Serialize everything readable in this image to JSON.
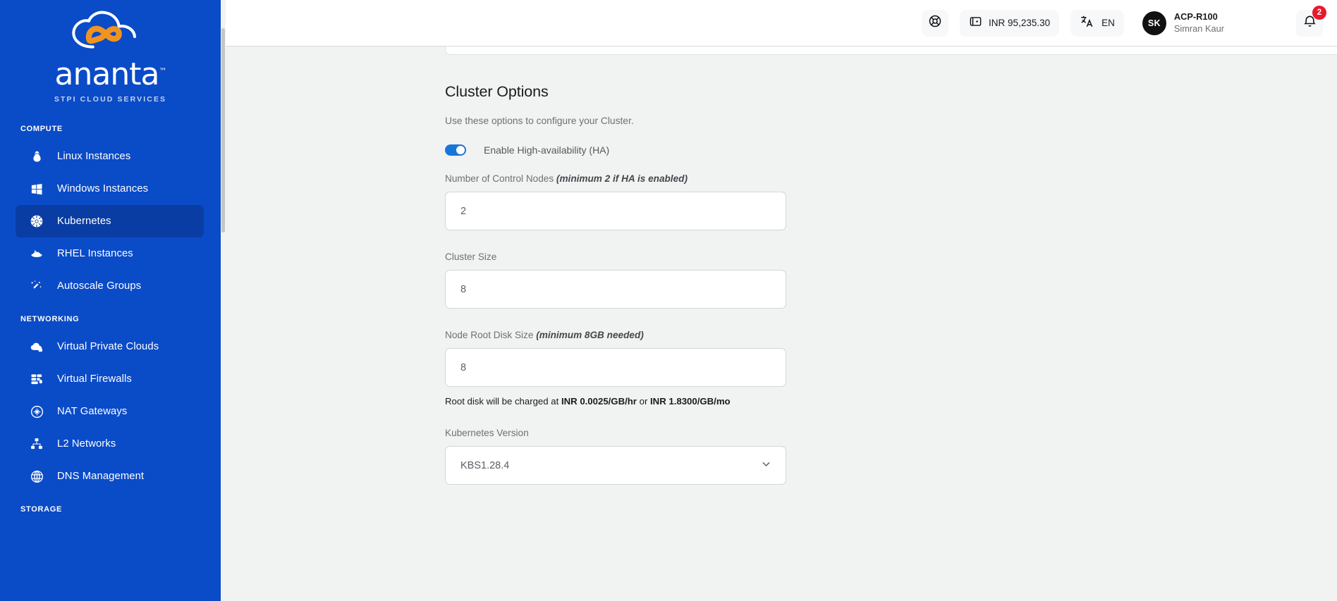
{
  "sidebar": {
    "logo": {
      "wordmark": "ananta",
      "trademark": "™",
      "subtitle": "STPI CLOUD SERVICES",
      "icon": "ananta-infinity-cloud-logo",
      "brand_blue": "#0a4bc8",
      "brand_orange": "#f0941f"
    },
    "sections": [
      {
        "label": "COMPUTE",
        "items": [
          {
            "label": "Linux Instances",
            "icon": "linux-penguin-icon",
            "active": false
          },
          {
            "label": "Windows Instances",
            "icon": "windows-icon",
            "active": false
          },
          {
            "label": "Kubernetes",
            "icon": "kubernetes-icon",
            "active": true
          },
          {
            "label": "RHEL Instances",
            "icon": "redhat-fedora-icon",
            "active": false
          },
          {
            "label": "Autoscale Groups",
            "icon": "magic-wand-icon",
            "active": false
          }
        ]
      },
      {
        "label": "NETWORKING",
        "items": [
          {
            "label": "Virtual Private Clouds",
            "icon": "cloud-lock-icon",
            "active": false
          },
          {
            "label": "Virtual Firewalls",
            "icon": "firewall-icon",
            "active": false
          },
          {
            "label": "NAT Gateways",
            "icon": "nat-gateway-icon",
            "active": false
          },
          {
            "label": "L2 Networks",
            "icon": "network-tree-icon",
            "active": false
          },
          {
            "label": "DNS Management",
            "icon": "globe-grid-icon",
            "active": false
          }
        ]
      },
      {
        "label": "STORAGE",
        "items": []
      }
    ]
  },
  "topbar": {
    "support": {
      "icon": "lifebuoy-icon"
    },
    "wallet": {
      "icon": "wallet-icon",
      "balance": "INR 95,235.30"
    },
    "language": {
      "icon": "translate-icon",
      "value": "EN"
    },
    "user": {
      "initials": "SK",
      "account_id": "ACP-R100",
      "name": "Simran Kaur"
    },
    "notifications": {
      "icon": "bell-icon",
      "count": "2",
      "badge_color": "#e8192c"
    }
  },
  "main": {
    "title": "Cluster Options",
    "subtitle": "Use these options to configure your Cluster.",
    "ha_toggle": {
      "label": "Enable High-availability (HA)",
      "enabled": true,
      "on_color": "#1677d9"
    },
    "fields": {
      "control_nodes": {
        "label": "Number of Control Nodes",
        "hint": "(minimum 2 if HA is enabled)",
        "value": "2"
      },
      "cluster_size": {
        "label": "Cluster Size",
        "hint": "",
        "value": "8"
      },
      "root_disk": {
        "label": "Node Root Disk Size",
        "hint": "(minimum 8GB needed)",
        "value": "8",
        "note_prefix": "Root disk will be charged at ",
        "note_rate_hourly": "INR 0.0025/GB/hr",
        "note_joiner": " or ",
        "note_rate_monthly": "INR 1.8300/GB/mo"
      },
      "k8s_version": {
        "label": "Kubernetes Version",
        "value": "KBS1.28.4",
        "chevron": "chevron-down-icon"
      }
    }
  }
}
